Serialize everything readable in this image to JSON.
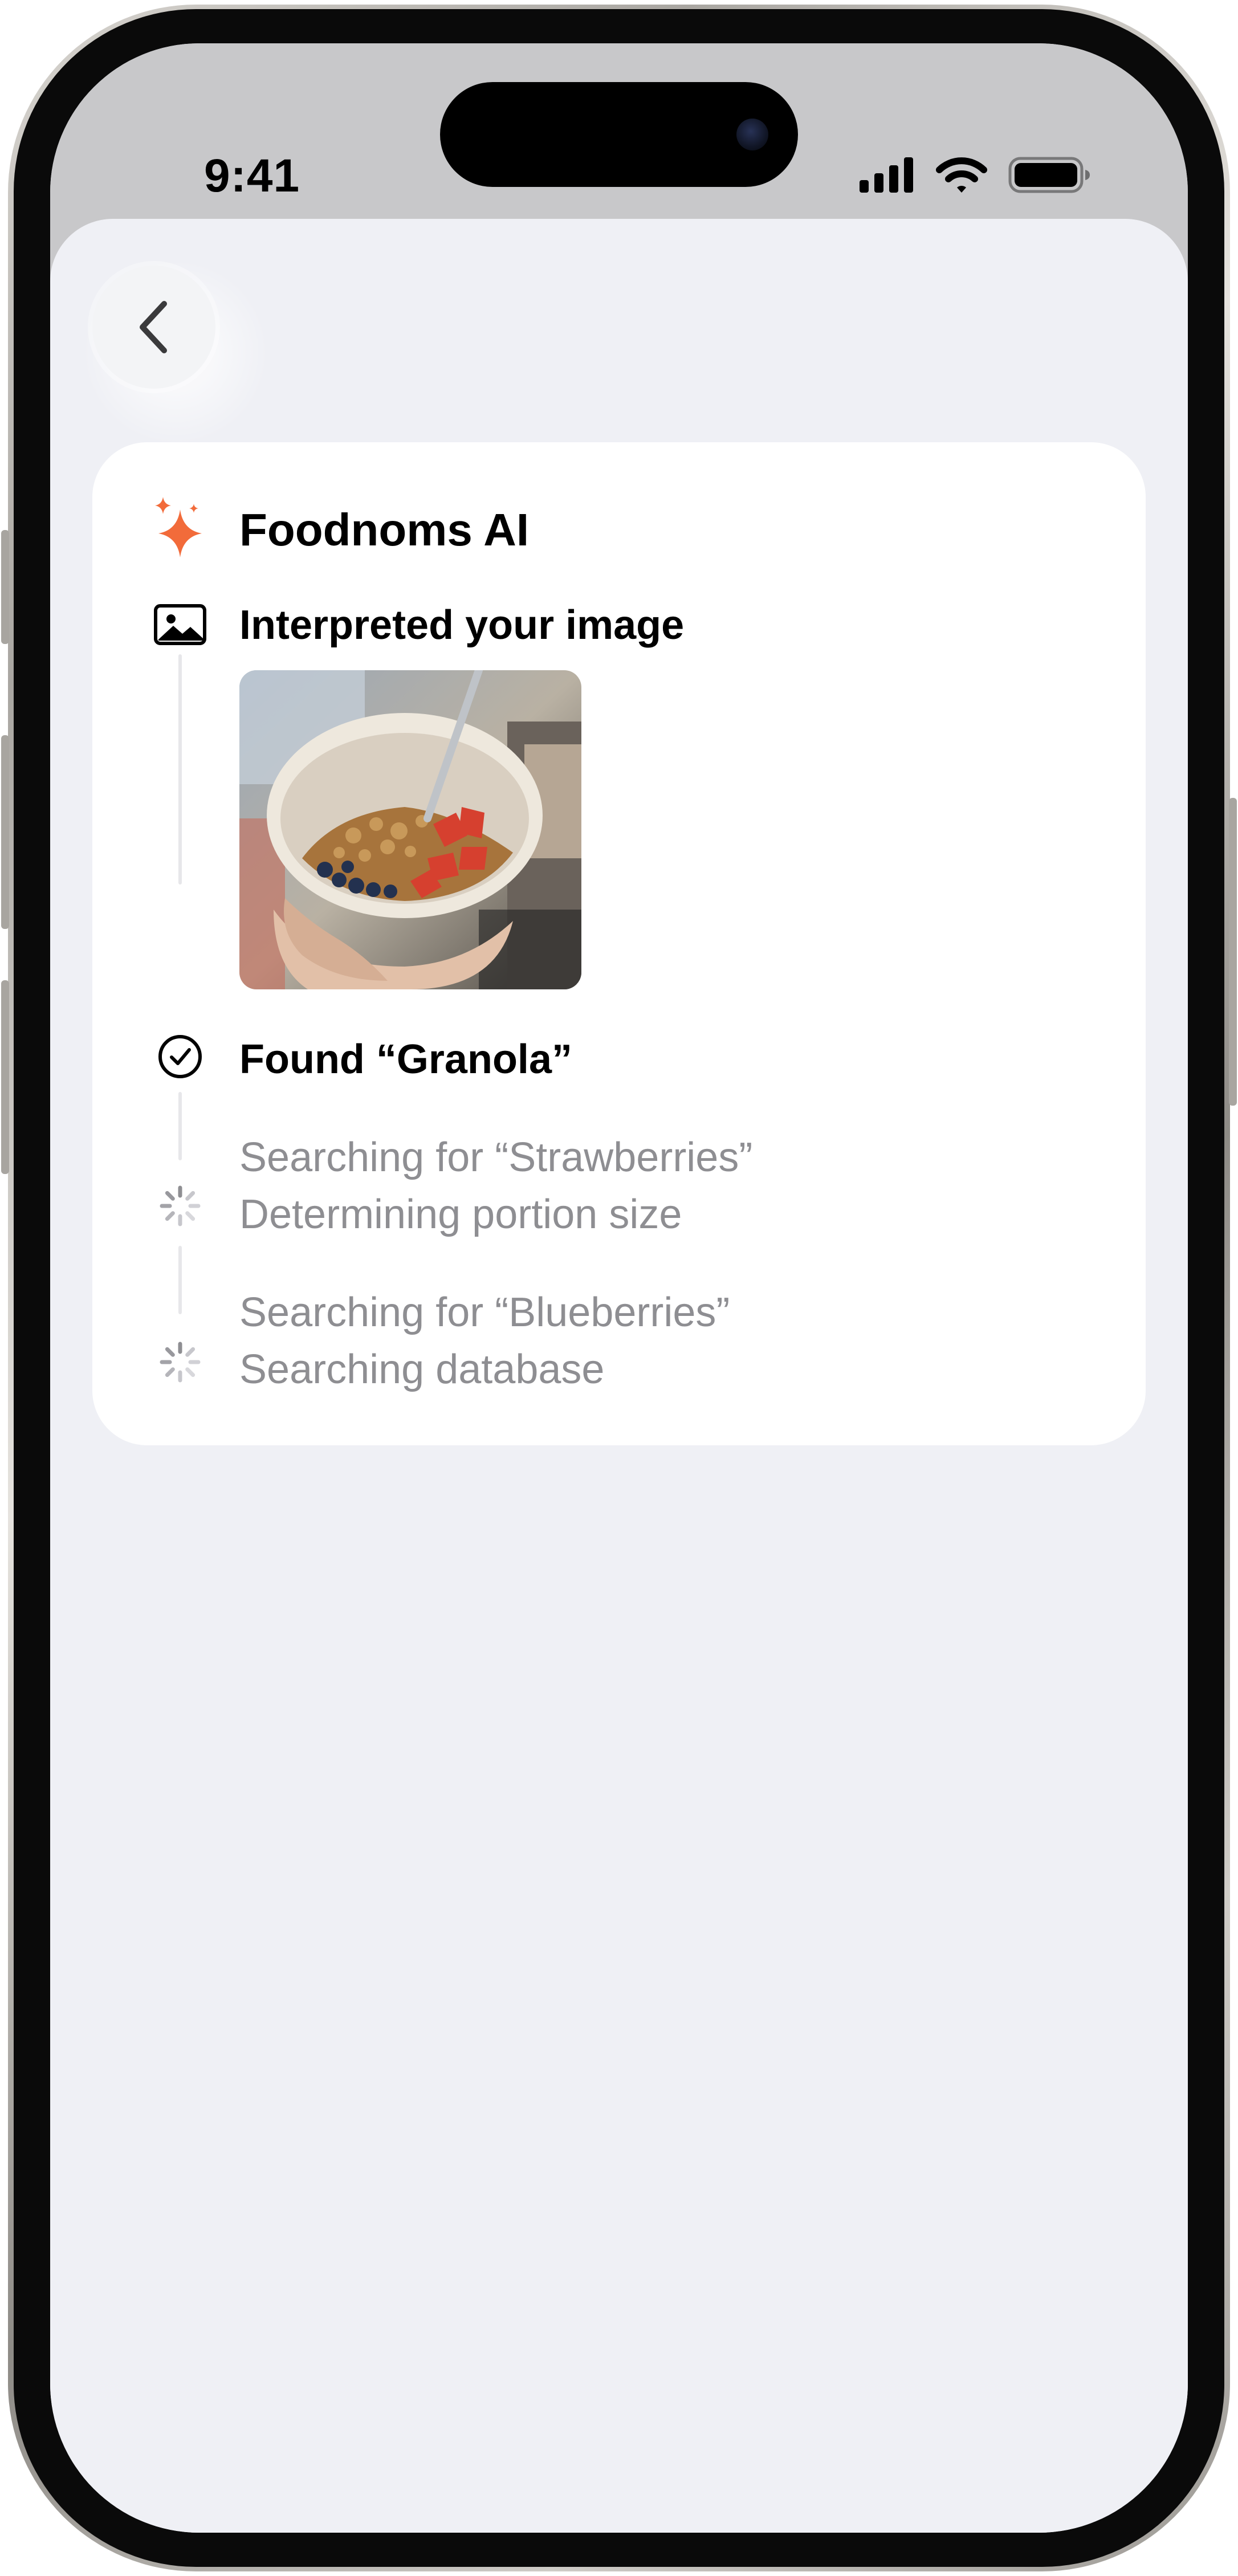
{
  "status_bar": {
    "time": "9:41"
  },
  "navigation": {
    "back_icon": "chevron-left-icon"
  },
  "assistant": {
    "title": "Foodnoms AI",
    "title_icon": "sparkles-icon",
    "accent_color": "#F26B3A"
  },
  "steps": [
    {
      "status": "done",
      "icon": "photo-icon",
      "title": "Interpreted your image"
    },
    {
      "status": "done",
      "icon": "checkmark-circle-icon",
      "title": "Found “Granola”"
    },
    {
      "status": "loading",
      "icon": "spinner-icon",
      "title": "Searching for “Strawberries”",
      "subtitle": "Determining portion size"
    },
    {
      "status": "loading",
      "icon": "spinner-icon",
      "title": "Searching for “Blueberries”",
      "subtitle": "Searching database"
    }
  ]
}
